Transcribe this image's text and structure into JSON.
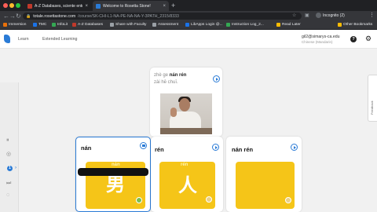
{
  "browser": {
    "tabs": [
      {
        "title": "A-Z Databases, sciente entre",
        "active": false,
        "favicon_color": "#c0392b"
      },
      {
        "title": "Welcome to Rosetta Stone!",
        "active": true,
        "favicon_color": "#2a7bd6"
      }
    ],
    "url_host": "totale.rosettastone.com",
    "url_path": "/course/SK-CHI-L1-NA-PE-NA-NA-Y-3PATH_2315/8333",
    "profile_label": "Incognito (2)",
    "bookmarks": [
      {
        "label": "Immersion",
        "color": "#e8710a"
      },
      {
        "label": "TMC",
        "color": "#1a73e8"
      },
      {
        "label": "InfoLit",
        "color": "#34a853"
      },
      {
        "label": "A-Z Databases",
        "color": "#c0392b"
      },
      {
        "label": "Share with Faculty",
        "color": "#9aa0a6"
      },
      {
        "label": "Assessment",
        "color": "#9aa0a6"
      },
      {
        "label": "LibApps Login @...",
        "color": "#1a73e8"
      },
      {
        "label": "Instruction Log_2...",
        "color": "#34a853"
      },
      {
        "label": "Read Later",
        "color": "#fbbc04"
      },
      {
        "label": "Other Bookmarks",
        "color": "#fbbc04"
      }
    ]
  },
  "app": {
    "nav": [
      "Learn",
      "Extended Learning"
    ],
    "user_email": "gil2@simarys-ca.edu",
    "user_language": "Chinese (Mandarin)",
    "feedback_label": "Feedback"
  },
  "prompt_card": {
    "line1_prefix": "zhè ge",
    "line1_highlight": "nán rén",
    "line2": "zài hē chuī."
  },
  "answer_cards": [
    {
      "label": "nán",
      "state": "pause",
      "tile_top": "nán",
      "tile_big": "男"
    },
    {
      "label": "rén",
      "state": "play",
      "tile_top": "rén",
      "tile_big": "人"
    },
    {
      "label": "nán rén",
      "state": "play",
      "tile_top": "",
      "tile_big": ""
    }
  ],
  "rail": {
    "step": "1"
  }
}
